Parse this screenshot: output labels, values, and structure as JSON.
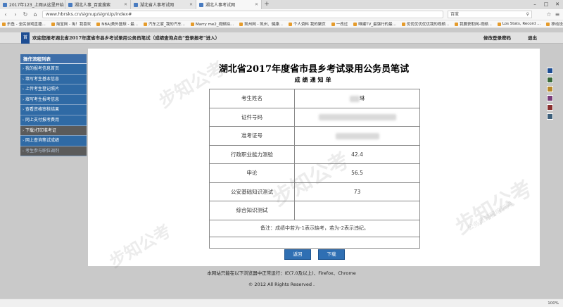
{
  "browser": {
    "tabs": [
      {
        "label": "2017年123_上网从这里开始",
        "active": false
      },
      {
        "label": "湖北人事_百度搜索",
        "active": false
      },
      {
        "label": "湖北省人事考试网",
        "active": false
      },
      {
        "label": "湖北人事考试网",
        "active": true
      }
    ],
    "new_tab_label": "+",
    "url": "www.hbrsks.cn/signup/signUp/index#",
    "search_engine": "百度",
    "bookmarks": [
      "乐鱼 - 全民游戏直播...",
      "淘宝网 - 淘！我喜欢",
      "NBA|美外篮球 - 最...",
      "汽车之家_我的汽车...",
      "Marry me2_视频拍...",
      "凯州网 - 凯州、健康...",
      "个人资料 我的聚页",
      "一改过",
      "唯建TV_最强行的最...",
      "优优优优优优我的视频...",
      "我要获取网-视频...",
      "Los Stats, Record ..."
    ],
    "bookmarks_more": "移动设备书签",
    "status_zoom": "100%"
  },
  "header": {
    "home_label": "首",
    "welcome": "欢迎您报考湖北省2017年度省市县乡考试录用公务员笔试（成绩查询点击“登录报考”进入）",
    "change_password": "修改登录密码",
    "logout": "退出"
  },
  "menu": {
    "title": "操作流程列表",
    "items": [
      {
        "label": "我的报考信息首页",
        "style": "blue"
      },
      {
        "label": "填写考生基本信息",
        "style": "blue"
      },
      {
        "label": "上传考生登记照片",
        "style": "blue"
      },
      {
        "label": "填写考生报考信息",
        "style": "blue"
      },
      {
        "label": "查看资格审核结果",
        "style": "blue"
      },
      {
        "label": "网上支付报考费用",
        "style": "blue"
      },
      {
        "label": "下载/打印准考证",
        "style": "alt"
      },
      {
        "label": "网上查询笔试成绩",
        "style": "blue"
      },
      {
        "label": "考生参与职位调剂",
        "style": "dim"
      }
    ]
  },
  "content": {
    "title": "湖北省2017年度省市县乡考试录用公务员笔试",
    "subtitle": "成绩通知单",
    "rows": [
      {
        "label": "考生姓名",
        "value": "琳"
      },
      {
        "label": "证件号码",
        "value": ""
      },
      {
        "label": "准考证号",
        "value": ""
      },
      {
        "label": "行政职业能力测验",
        "value": "42.4"
      },
      {
        "label": "申论",
        "value": "56.5"
      },
      {
        "label": "公安基础知识测试",
        "value": "73"
      },
      {
        "label": "综合知识测试",
        "value": ""
      }
    ],
    "note": "备注：成绩中若为-1表示缺考，若为-2表示违纪。",
    "back_button": "返回",
    "download_button": "下载"
  },
  "footer": {
    "browser_support": "本网站只能在以下浏览器中正常运行：IE(7.0及以上)、Firefox、Chrome",
    "copyright": "© 2012 All Rights Reserved ."
  },
  "theme_colors": [
    "#1d4d93",
    "#3a6a3a",
    "#b8892a",
    "#7a3d7a",
    "#8a3030",
    "#3d5f7a"
  ],
  "watermark": "步知公考",
  "watermark_sub": "公务员课程培训网"
}
